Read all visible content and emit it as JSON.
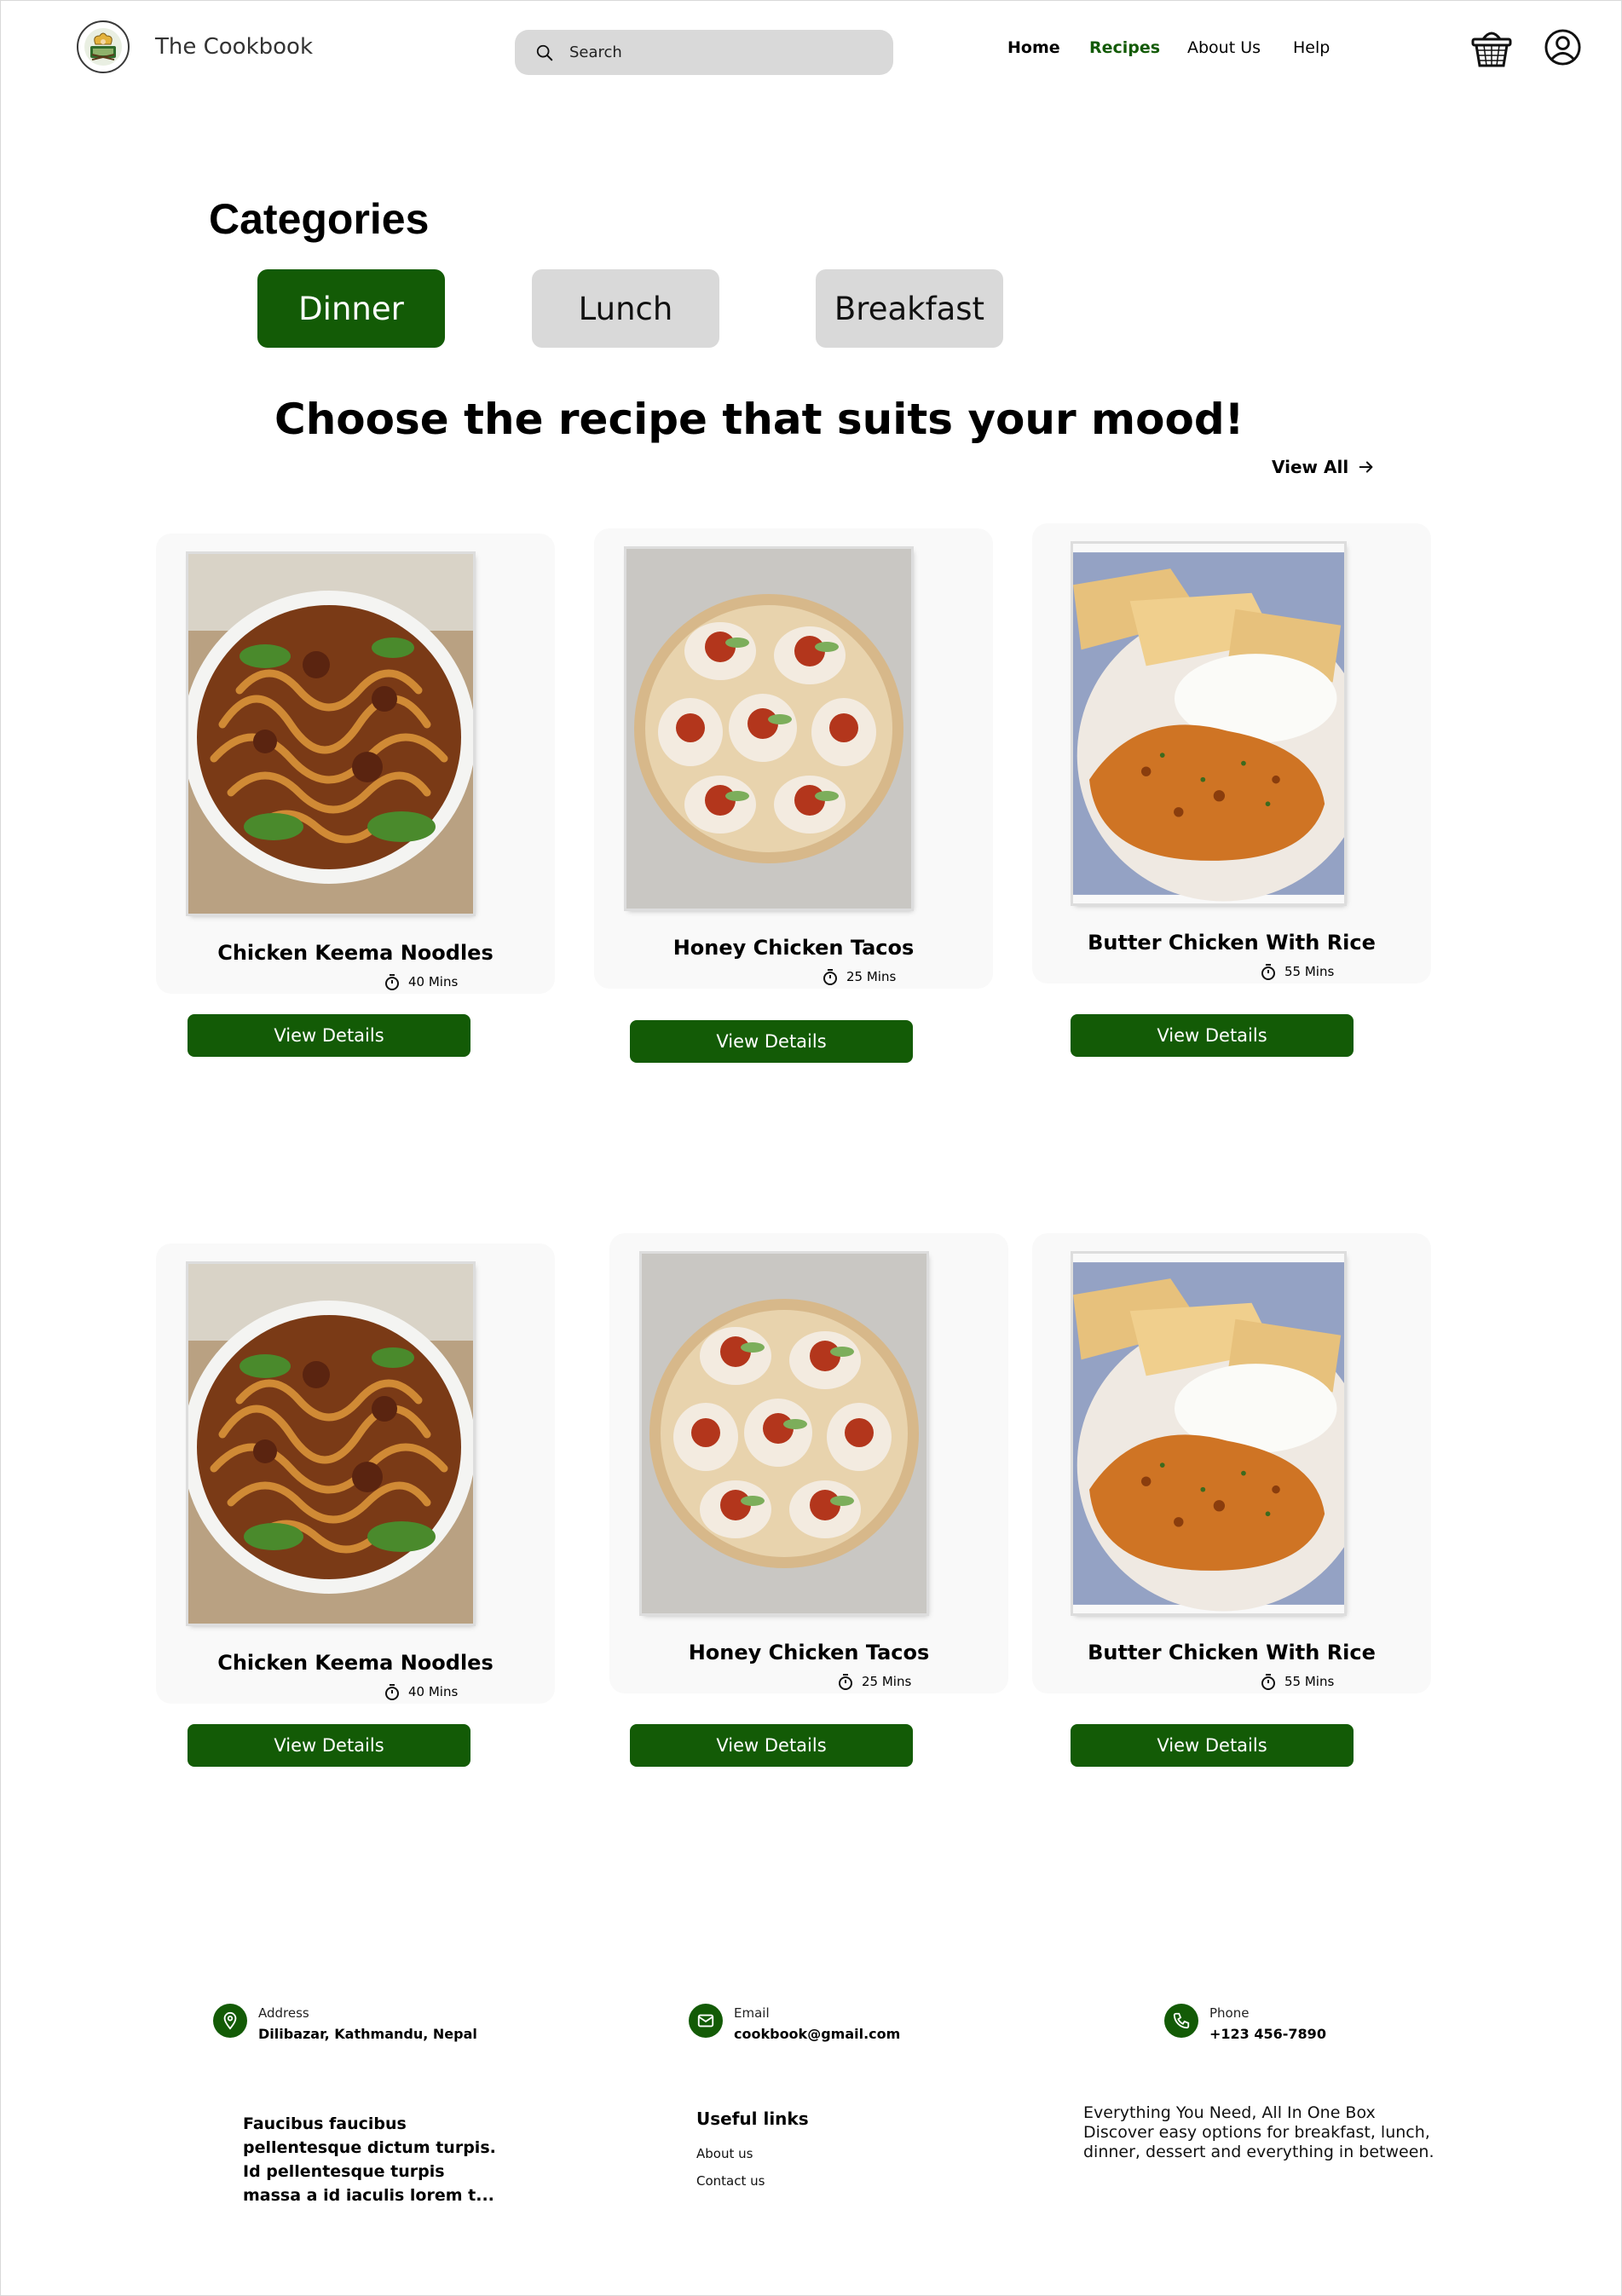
{
  "header": {
    "brand": "The Cookbook",
    "search_placeholder": "Search",
    "nav": [
      {
        "label": "Home"
      },
      {
        "label": "Recipes",
        "active": true
      },
      {
        "label": "About Us"
      },
      {
        "label": "Help"
      }
    ],
    "icons": [
      "chef-logo-icon",
      "search-icon",
      "shopping-basket-icon",
      "user-profile-icon"
    ]
  },
  "categories": {
    "heading": "Categories",
    "items": [
      {
        "label": "Dinner",
        "active": true
      },
      {
        "label": "Lunch"
      },
      {
        "label": "Breakfast"
      }
    ]
  },
  "recipes": {
    "headline": "Choose the recipe that suits your mood!",
    "view_all": "View All",
    "button_label": "View Details",
    "cards": [
      {
        "title": "Chicken Keema Noodles",
        "time": "40 Mins"
      },
      {
        "title": "Honey Chicken Tacos",
        "time": "25 Mins"
      },
      {
        "title": "Butter Chicken With Rice",
        "time": "55 Mins"
      },
      {
        "title": "Chicken Keema Noodles",
        "time": "40 Mins"
      },
      {
        "title": "Honey Chicken Tacos",
        "time": "25 Mins"
      },
      {
        "title": "Butter Chicken With Rice",
        "time": "55 Mins"
      }
    ]
  },
  "footer": {
    "contacts": [
      {
        "label": "Address",
        "value": "Dilibazar, Kathmandu, Nepal",
        "icon": "location-pin-icon"
      },
      {
        "label": "Email",
        "value": "cookbook@gmail.com",
        "icon": "mail-icon"
      },
      {
        "label": "Phone",
        "value": "+123 456-7890",
        "icon": "phone-icon"
      }
    ],
    "blurb": "Faucibus faucibus pellentesque dictum turpis. Id pellentesque turpis massa a id iaculis lorem t...",
    "links_heading": "Useful links",
    "links": [
      "About us",
      "Contact us"
    ],
    "about_lines": [
      "Everything You Need, All In One Box",
      "Discover easy options for breakfast, lunch,",
      "dinner, dessert and everything in between."
    ]
  },
  "colors": {
    "brand_green": "#135b06",
    "inactive_gray": "#d9d9d9",
    "card_bg": "#f9f9f9"
  }
}
